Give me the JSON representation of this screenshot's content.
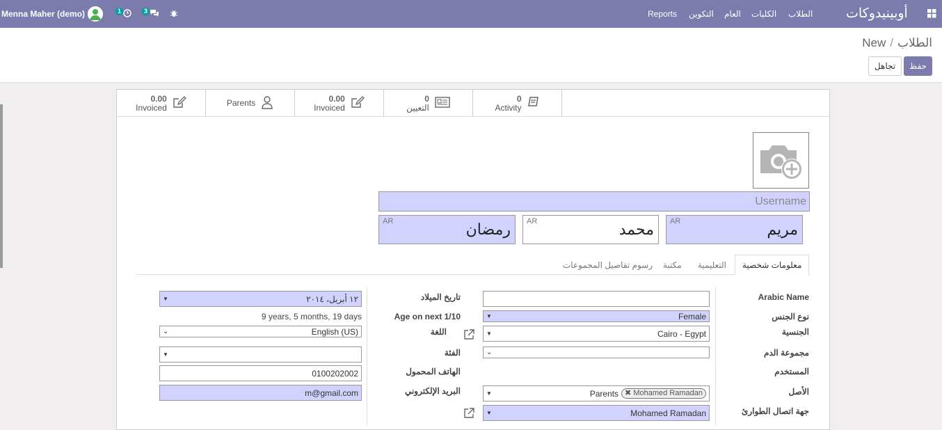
{
  "navbar": {
    "brand": "أوبينيدوكات",
    "menu": [
      "الطلاب",
      "الكليات",
      "العام",
      "التكوين",
      "Reports"
    ],
    "user_name": "Menna Maher (demo)",
    "activity_count": "1",
    "messages_count": "3"
  },
  "breadcrumb": {
    "parent": "الطلاب",
    "separator": "/",
    "current": "New"
  },
  "buttons": {
    "save": "حفظ",
    "discard": "تجاهل"
  },
  "stat_buttons": [
    {
      "value": "0",
      "label": "Activity",
      "icon": "book-icon"
    },
    {
      "value": "0",
      "label": "التعيين",
      "icon": "id-card-icon"
    },
    {
      "value": "0.00",
      "label": "Invoiced",
      "icon": "edit-icon"
    },
    {
      "value": "",
      "label": "Parents",
      "icon": "user-icon"
    },
    {
      "value": "0.00",
      "label": "Invoiced",
      "icon": "edit-icon"
    }
  ],
  "form": {
    "username_placeholder": "Username",
    "lang_tag": "AR",
    "first_name": "مريم",
    "middle_name": "محمد",
    "last_name": "رمضان"
  },
  "tabs": [
    "معلومات شخصية",
    "التعليمية",
    "مكتبة",
    "رسوم تفاصيل المجموعات"
  ],
  "fields": {
    "arabic_name": {
      "label": "Arabic Name",
      "value": ""
    },
    "gender": {
      "label": "نوع الجنس",
      "value": "Female"
    },
    "nationality": {
      "label": "الجنسية",
      "value": "Cairo - Egypt"
    },
    "blood_group": {
      "label": "مجموعة الدم",
      "value": ""
    },
    "user": {
      "label": "المستخدم",
      "value": ""
    },
    "origin": {
      "label": "الأصل",
      "tag": "Mohamed Ramadan",
      "value": "Parents"
    },
    "emergency_contact": {
      "label": "جهة اتصال الطوارئ",
      "value": "Mohamed Ramadan"
    },
    "birth_date": {
      "label": "تاريخ الميلاد",
      "value": "١٢ أبريل، ٢٠١٤"
    },
    "age_next": {
      "label": "Age on next 1/10",
      "value": "9 years, 5 months, 19 days"
    },
    "language": {
      "label": "اللغة",
      "value": "English (US)"
    },
    "category": {
      "label": "الفئة",
      "value": ""
    },
    "mobile": {
      "label": "الهاتف المحمول",
      "value": "0100202002"
    },
    "email": {
      "label": "البريد الإلكتروني",
      "value": "m@gmail.com"
    }
  },
  "colors": {
    "navbar": "#7c7bad",
    "required": "#d2d2ff",
    "badge": "#00a09d"
  }
}
